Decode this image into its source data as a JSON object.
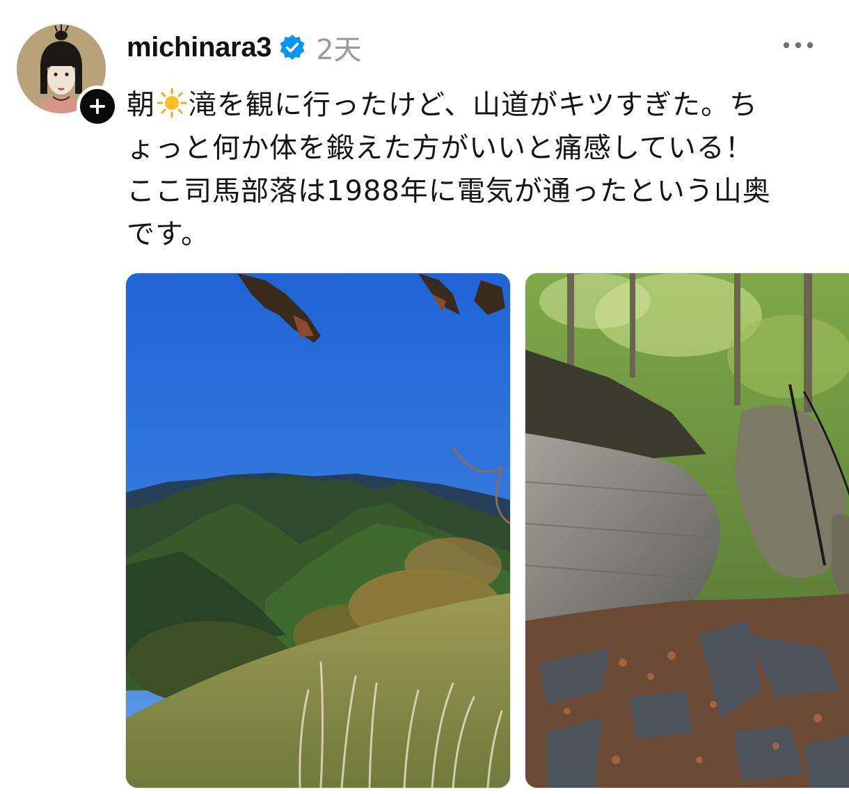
{
  "post": {
    "username": "michinara3",
    "timestamp": "2天",
    "text_before_emoji": "朝",
    "emoji": "☀️",
    "lines": [
      "滝を観に行ったけど、山道がキツすぎた。ち",
      "ょっと何か体を鍛えた方がいいと痛感している！",
      "ここ司馬部落は1988年に電気が通ったという山奥",
      "です。"
    ]
  },
  "icons": {
    "verified": "verified-badge-icon",
    "follow": "plus-icon",
    "more": "more-options-icon"
  },
  "colors": {
    "verified_blue": "#0095f6",
    "timestamp_gray": "#9a9a9a",
    "text": "#141414"
  },
  "media": [
    {
      "kind": "photo",
      "subject": "mountain-view-photo"
    },
    {
      "kind": "photo",
      "subject": "rocky-trail-photo"
    }
  ]
}
